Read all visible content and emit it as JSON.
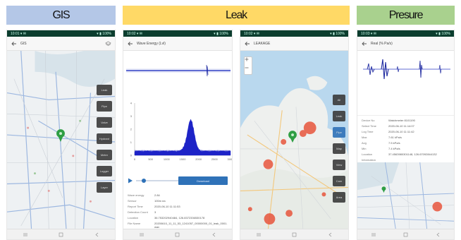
{
  "headers": {
    "gis": "GIS",
    "leak": "Leak",
    "pressure": "Presure"
  },
  "colors": {
    "gis": "#b4c7e7",
    "leak": "#ffd966",
    "pressure": "#a9d18e",
    "accent": "#2f72b8",
    "leak_marker": "#e8553c",
    "pin": "#2e9e44"
  },
  "gis_screen": {
    "status_left": "10:01 ▾ ✉",
    "status_right": "▾ ▮ 100%",
    "title": "GIS",
    "side_buttons": [
      "Leak",
      "Pipe",
      "Valve",
      "Hydrant",
      "Meter",
      "Logger",
      "Layer"
    ]
  },
  "leak_detail_screen": {
    "status_left": "10:02 ▾ ✉",
    "status_right": "▾ ▮ 100%",
    "title": "Wave Energy (Lvl)",
    "x_ticks": [
      "0",
      "500",
      "1000",
      "1500",
      "2000",
      "2500",
      "3000"
    ],
    "y_ticks": [
      "4",
      "3",
      "2",
      "1",
      "0"
    ],
    "open_button": "Download",
    "info": [
      {
        "label": "Wave energy",
        "value": "2.84"
      },
      {
        "label": "Sensor",
        "value": "100m ea"
      },
      {
        "label": "Report Time",
        "value": "2020-06-10 11:11:53"
      },
      {
        "label": "Detection Count",
        "value": "3"
      },
      {
        "label": "Location",
        "value": "36.753202940484, 126.8372336530178"
      },
      {
        "label": "File Name",
        "value": "20200610_11_11_53_1241057_00000000_01_leak_0001.wav"
      }
    ]
  },
  "leak_map_screen": {
    "status_left": "10:02 ▾ ✉",
    "status_right": "▾ ▮ 100%",
    "title": "LEAKAGE",
    "side_buttons": [
      "All",
      "Leak",
      "Pipe",
      "Map",
      "View",
      "Cam",
      "Area"
    ]
  },
  "pressure_screen": {
    "status_left": "10:03 ▾ ✉",
    "status_right": "▾ ▮ 100%",
    "title": "Real (% Pa/s)",
    "info": [
      {
        "label": "Device No",
        "value": "Watchmeter 8101190"
      },
      {
        "label": "Select Time",
        "value": "2020-06-10 11:14:07"
      },
      {
        "label": "Log Time",
        "value": "2020-06-10 11:11:42"
      },
      {
        "label": "Max",
        "value": "7.61 kPa/s"
      },
      {
        "label": "Avg",
        "value": "7.5 kPa/s"
      },
      {
        "label": "Min",
        "value": "7.4 kPa/s"
      },
      {
        "label": "Location",
        "value": "37.4563980301148, 126.67092844132"
      }
    ],
    "info_footer": "Information"
  }
}
